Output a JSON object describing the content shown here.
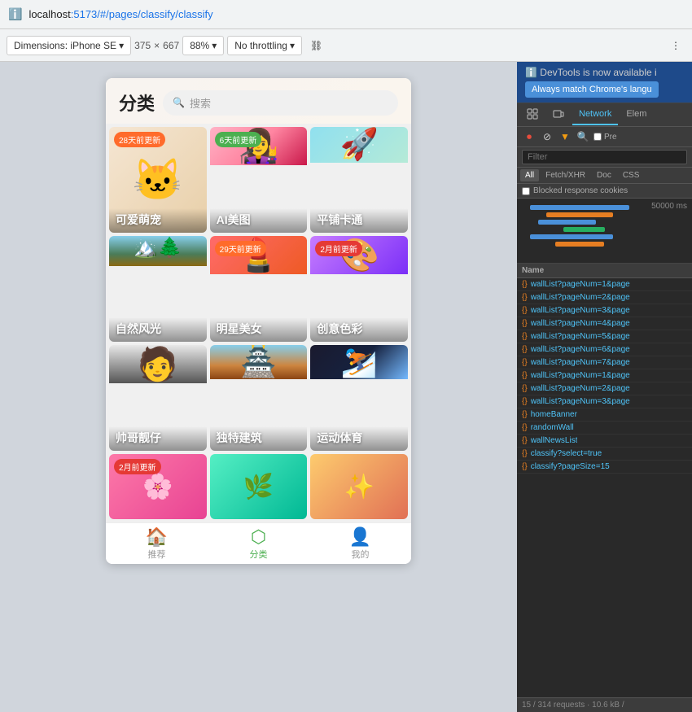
{
  "browser": {
    "url_prefix": "localhost",
    "url_port": ":5173",
    "url_path": "/#/pages/classify/classify",
    "toolbar": {
      "dimensions_label": "Dimensions: iPhone SE",
      "width": "375",
      "x_sep": "×",
      "height": "667",
      "zoom": "88%",
      "throttling": "No throttling",
      "more_tools_label": "⋮"
    }
  },
  "app": {
    "title": "分类",
    "search_placeholder": "搜索",
    "categories": [
      {
        "label": "可爱萌宠",
        "badge": "28天前更新",
        "badge_type": "orange",
        "emoji": "🐱"
      },
      {
        "label": "AI美图",
        "badge": "6天前更新",
        "badge_type": "green",
        "emoji": "👩"
      },
      {
        "label": "平铺卡通",
        "badge": "",
        "badge_type": "",
        "emoji": "🚀"
      },
      {
        "label": "自然风光",
        "badge": "",
        "badge_type": "",
        "emoji": "🏔️"
      },
      {
        "label": "明星美女",
        "badge": "29天前更新",
        "badge_type": "orange",
        "emoji": "💄"
      },
      {
        "label": "创意色彩",
        "badge": "2月前更新",
        "badge_type": "red",
        "emoji": "🎨"
      },
      {
        "label": "帅哥靓仔",
        "badge": "",
        "badge_type": "",
        "emoji": "🧑"
      },
      {
        "label": "独特建筑",
        "badge": "",
        "badge_type": "",
        "emoji": "🏯"
      },
      {
        "label": "运动体育",
        "badge": "",
        "badge_type": "",
        "emoji": "⛷️"
      },
      {
        "label": "",
        "badge": "2月前更新",
        "badge_type": "red",
        "emoji": "🌸"
      },
      {
        "label": "",
        "badge": "",
        "badge_type": "",
        "emoji": "🌿"
      },
      {
        "label": "",
        "badge": "",
        "badge_type": "",
        "emoji": "✨"
      }
    ],
    "nav": [
      {
        "label": "推荐",
        "icon": "🏠",
        "active": false
      },
      {
        "label": "分类",
        "icon": "🔷",
        "active": true
      },
      {
        "label": "我的",
        "icon": "👤",
        "active": false
      }
    ]
  },
  "devtools": {
    "banner_text": "DevTools is now available i",
    "banner_button": "Always match Chrome's langu",
    "tabs": [
      "",
      "Network",
      "Elem"
    ],
    "active_tab": "Network",
    "toolbar_buttons": [
      "⏺",
      "⊘",
      "▼",
      "🔍"
    ],
    "pre_label": "Pre",
    "filter_placeholder": "Filter",
    "filter_tabs": [
      "All",
      "Fetch/XHR",
      "Doc",
      "CSS"
    ],
    "active_filter": "All",
    "blocked_cookies": "Blocked response cookies",
    "waterfall_time": "50000 ms",
    "network_column": "Name",
    "requests": [
      "wallList?pageNum=1&page",
      "wallList?pageNum=2&page",
      "wallList?pageNum=3&page",
      "wallList?pageNum=4&page",
      "wallList?pageNum=5&page",
      "wallList?pageNum=6&page",
      "wallList?pageNum=7&page",
      "wallList?pageNum=1&page",
      "wallList?pageNum=2&page",
      "wallList?pageNum=3&page",
      "homeBanner",
      "randomWall",
      "wallNewsList",
      "classify?select=true",
      "classify?pageSize=15"
    ],
    "footer": "15 / 314 requests · 10.6 kB /"
  }
}
